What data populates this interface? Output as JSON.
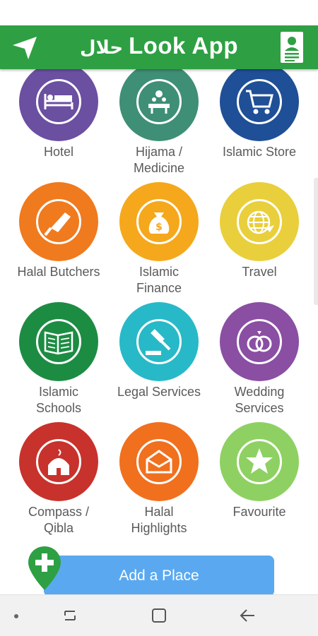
{
  "app": {
    "title_arabic": "حلال",
    "title": "Look App"
  },
  "colors": {
    "appbar": "#2ea043",
    "add_place_button": "#5aa9f0",
    "pin": "#2ea043"
  },
  "tiles": [
    {
      "label": "Hotel",
      "color": "#6b4fa1",
      "icon": "bed-icon"
    },
    {
      "label": "Hijama /\nMedicine",
      "color": "#3e8f75",
      "icon": "hijama-icon"
    },
    {
      "label": "Islamic Store",
      "color": "#1f4f96",
      "icon": "cart-icon"
    },
    {
      "label": "Halal Butchers",
      "color": "#f07a1e",
      "icon": "cleaver-icon"
    },
    {
      "label": "Islamic\nFinance",
      "color": "#f5a81c",
      "icon": "money-bag-icon"
    },
    {
      "label": "Travel",
      "color": "#e9cf3b",
      "icon": "globe-plane-icon"
    },
    {
      "label": "Islamic\nSchools",
      "color": "#1d8c43",
      "icon": "book-icon"
    },
    {
      "label": "Legal Services",
      "color": "#28b9c8",
      "icon": "gavel-icon"
    },
    {
      "label": "Wedding\nServices",
      "color": "#8a4ea3",
      "icon": "rings-icon"
    },
    {
      "label": "Compass /\nQibla",
      "color": "#c8322c",
      "icon": "mosque-icon"
    },
    {
      "label": "Halal\nHighlights",
      "color": "#f0701e",
      "icon": "envelope-icon"
    },
    {
      "label": "Favourite",
      "color": "#8ed162",
      "icon": "star-icon"
    }
  ],
  "add_place": {
    "label": "Add a Place"
  }
}
